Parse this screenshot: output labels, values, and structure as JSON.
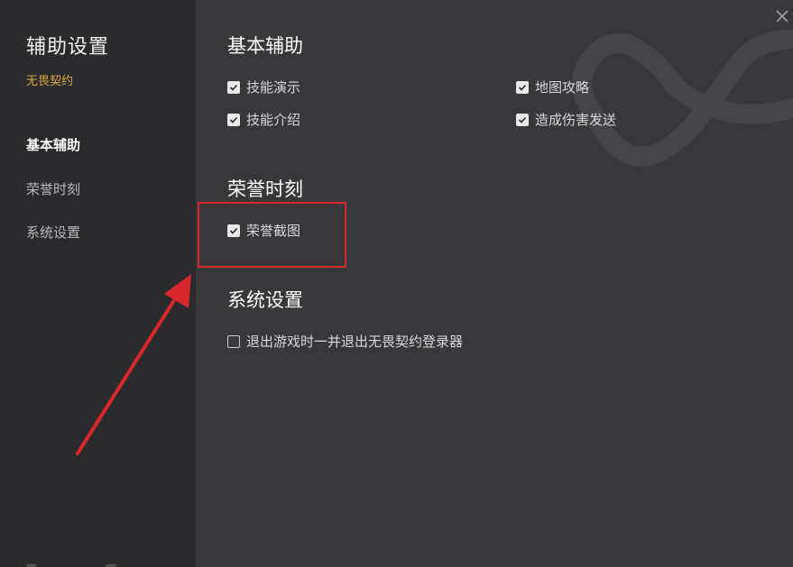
{
  "sidebar": {
    "title": "辅助设置",
    "subtitle": "无畏契约",
    "items": [
      {
        "label": "基本辅助",
        "active": true
      },
      {
        "label": "荣誉时刻",
        "active": false
      },
      {
        "label": "系统设置",
        "active": false
      }
    ]
  },
  "sections": {
    "basic": {
      "title": "基本辅助",
      "options": [
        {
          "label": "技能演示",
          "checked": true
        },
        {
          "label": "地图攻略",
          "checked": true
        },
        {
          "label": "技能介绍",
          "checked": true
        },
        {
          "label": "造成伤害发送",
          "checked": true
        }
      ]
    },
    "honor": {
      "title": "荣誉时刻",
      "options": [
        {
          "label": "荣誉截图",
          "checked": true
        }
      ]
    },
    "system": {
      "title": "系统设置",
      "options": [
        {
          "label": "退出游戏时一并退出无畏契约登录器",
          "checked": false
        }
      ]
    }
  },
  "colors": {
    "background": "#38383b",
    "sidebar": "#2b2b2d",
    "accent": "#d9a93a",
    "annotation": "#d8262d"
  },
  "icons": [
    "close-icon",
    "checkbox-checked-icon",
    "checkbox-unchecked-icon",
    "annotation-arrow"
  ]
}
